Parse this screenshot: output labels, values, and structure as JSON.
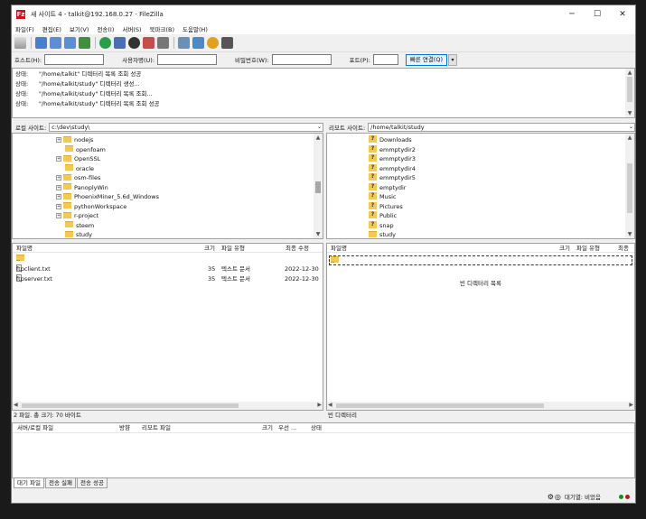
{
  "window": {
    "title": "새 사이트 4 - talkit@192.168.0.27 - FileZilla",
    "app_icon": "Fz"
  },
  "controls": {
    "minimize": "─",
    "maximize": "☐",
    "close": "✕"
  },
  "menu": [
    "파일(F)",
    "편집(E)",
    "보기(V)",
    "전송(I)",
    "서버(S)",
    "북마크(B)",
    "도움말(H)"
  ],
  "quickconnect": {
    "host": "호스트(H):",
    "user": "사용자명(U):",
    "pass": "비밀번호(W):",
    "port": "포트(P):",
    "button": "빠른 연결(Q)",
    "dropdown": "▾"
  },
  "log": [
    {
      "k": "상태:",
      "v": "\"/home/talkit\" 디렉터리 목록 조회 성공"
    },
    {
      "k": "상태:",
      "v": "\"/home/talkit/study\" 디렉터리 생성..."
    },
    {
      "k": "상태:",
      "v": "\"/home/talkit/study\" 디렉터리 목록 조회..."
    },
    {
      "k": "상태:",
      "v": "\"/home/talkit/study\" 디렉터리 목록 조회 성공"
    }
  ],
  "local": {
    "site_label": "로컬 사이트:",
    "path": "c:\\dev\\study\\",
    "tree": [
      {
        "name": "nodejs",
        "expander": "+"
      },
      {
        "name": "openfoam",
        "expander": ""
      },
      {
        "name": "OpenSSL",
        "expander": "+"
      },
      {
        "name": "oracle",
        "expander": ""
      },
      {
        "name": "osm-files",
        "expander": "+"
      },
      {
        "name": "PanoplyWin",
        "expander": "+"
      },
      {
        "name": "PhoenixMiner_5.6d_Windows",
        "expander": "+"
      },
      {
        "name": "pythonWorkspace",
        "expander": "+"
      },
      {
        "name": "r-project",
        "expander": "+"
      },
      {
        "name": "steem",
        "expander": ""
      },
      {
        "name": "study",
        "expander": ""
      }
    ],
    "columns": {
      "name": "파일명",
      "size": "크기",
      "type": "파일 유형",
      "modified": "최종 수정"
    },
    "files": [
      {
        "name": "..",
        "size": "",
        "type": "",
        "modified": ""
      },
      {
        "name": "ftpclient.txt",
        "size": "35",
        "type": "텍스트 문서",
        "modified": "2022-12-30"
      },
      {
        "name": "ftpserver.txt",
        "size": "35",
        "type": "텍스트 문서",
        "modified": "2022-12-30"
      }
    ],
    "status": "2 파일. 총 크기: 70 바이트"
  },
  "remote": {
    "site_label": "리모트 사이트:",
    "path": "/home/talkit/study",
    "tree": [
      "Downloads",
      "emmptydir2",
      "emmptydir3",
      "emmptydir4",
      "emmptydir5",
      "emptydir",
      "Music",
      "Pictures",
      "Public",
      "snap",
      "study"
    ],
    "columns": {
      "name": "파일명",
      "size": "크기",
      "type": "파일 유형",
      "modified": "최종"
    },
    "row0": "..",
    "empty_msg": "빈 디렉터리 목록",
    "status": "빈 디렉터리"
  },
  "queue": {
    "columns": {
      "file": "서버/로컬 파일",
      "dir": "방향",
      "remote": "리모트 파일",
      "size": "크기",
      "priority": "우선 ...",
      "state": "상태"
    }
  },
  "tabs": [
    "대기 파일",
    "전송 실패",
    "전송 성공"
  ],
  "bottom": {
    "queue": "대기열: 비었음"
  },
  "colors": {
    "accent": "#0078d7",
    "folder": "#f3c855",
    "brand": "#c8161d"
  }
}
